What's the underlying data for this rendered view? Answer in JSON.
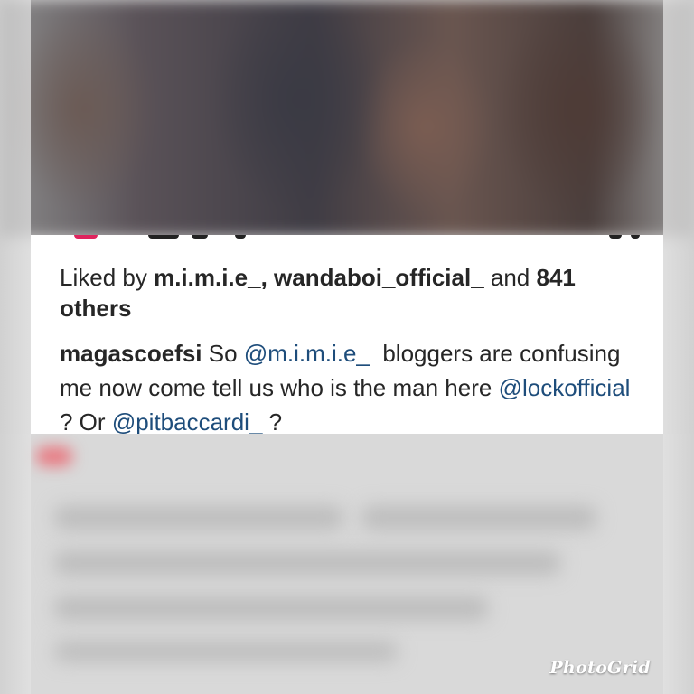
{
  "post": {
    "liked_prefix": "Liked by",
    "liker_1": "m.i.m.i.e_,",
    "liker_2": "wandaboi_official_",
    "liked_and": "and",
    "others": "841 others"
  },
  "comment": {
    "username": "magascoefsi",
    "part_1": "So",
    "mention_1": "@m.i.m.i.e_",
    "part_2": "bloggers are confusing me now come tell us who is the man here",
    "mention_2": "@lockofficial",
    "part_3": "? Or",
    "mention_3": "@pitbaccardi_",
    "part_4": "?"
  },
  "watermark": {
    "text": "PhotoGrid"
  },
  "colors": {
    "mention": "#1e4d7b",
    "text": "#262626",
    "panel": "#ffffff",
    "background": "#d6d6d6"
  }
}
